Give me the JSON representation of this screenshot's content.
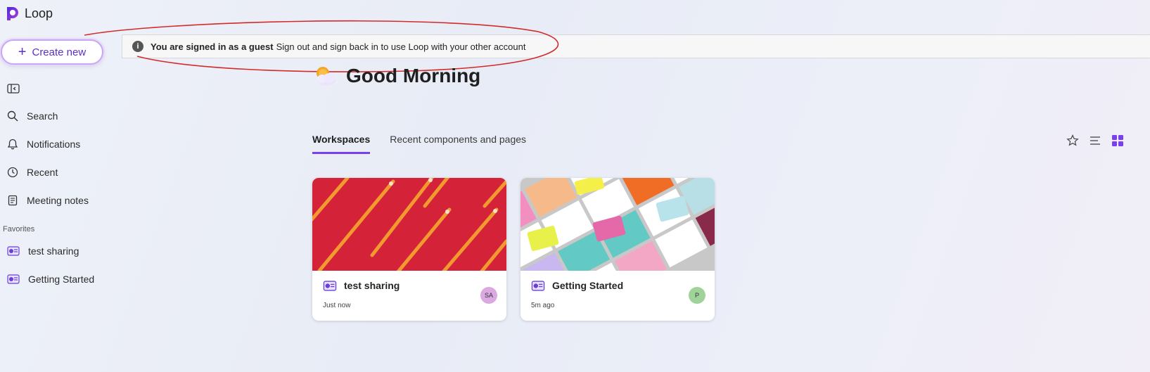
{
  "app": {
    "name": "Loop"
  },
  "sidebar": {
    "create_label": "Create new",
    "nav": [
      {
        "label": "Search",
        "icon": "search-icon"
      },
      {
        "label": "Notifications",
        "icon": "bell-icon"
      },
      {
        "label": "Recent",
        "icon": "clock-icon"
      },
      {
        "label": "Meeting notes",
        "icon": "notes-icon"
      }
    ],
    "favorites_label": "Favorites",
    "favorites": [
      {
        "label": "test sharing",
        "icon": "workspace-icon"
      },
      {
        "label": "Getting Started",
        "icon": "workspace-icon"
      }
    ]
  },
  "banner": {
    "bold": "You are signed in as a guest",
    "text": "Sign out and sign back in to use Loop with your other account"
  },
  "greeting": {
    "text": "Good Morning",
    "icon": "weather-sun-cloud-icon"
  },
  "tabs": [
    {
      "label": "Workspaces",
      "active": true
    },
    {
      "label": "Recent components and pages",
      "active": false
    }
  ],
  "view_controls": [
    "star-icon",
    "list-view-icon",
    "grid-view-icon"
  ],
  "cards": [
    {
      "title": "test sharing",
      "time": "Just now",
      "avatar": "SA",
      "avatar_color": "#d9a9e0",
      "thumb": "red-pencils"
    },
    {
      "title": "Getting Started",
      "time": "5m ago",
      "avatar": "P",
      "avatar_color": "#9fd39a",
      "thumb": "sticky-notes"
    }
  ],
  "colors": {
    "accent": "#7a3ff0",
    "annotation": "#d42a2a"
  }
}
